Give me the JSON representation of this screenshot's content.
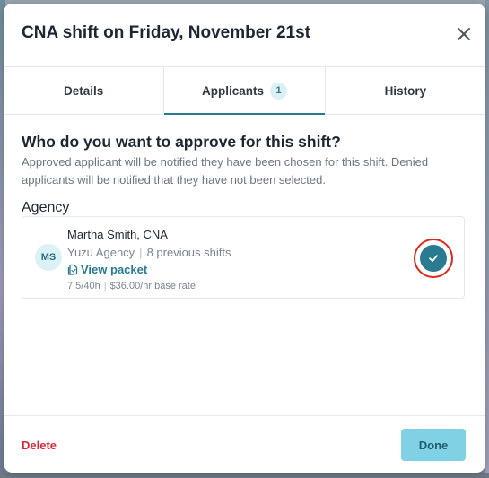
{
  "modal": {
    "title": "CNA shift on Friday, November 21st",
    "close_icon": "close-icon"
  },
  "tabs": [
    {
      "label": "Details",
      "active": false
    },
    {
      "label": "Applicants",
      "badge": "1",
      "active": true
    },
    {
      "label": "History",
      "active": false
    }
  ],
  "prompt": {
    "heading": "Who do you want to approve for this shift?",
    "description": "Approved applicant will be notified they have been chosen for this shift. Denied applicants will be notified that they have not been selected."
  },
  "section": {
    "label": "Agency"
  },
  "applicant": {
    "initials": "MS",
    "name": "Martha Smith, CNA",
    "agency": "Yuzu Agency",
    "separator": "|",
    "previous_shifts": "8 previous shifts",
    "view_packet_label": "View packet",
    "hours": "7.5/40h",
    "rate": "$36.00/hr base rate",
    "approve_icon": "checkmark-icon",
    "approved": true
  },
  "footer": {
    "delete_label": "Delete",
    "done_label": "Done"
  },
  "colors": {
    "accent": "#2a7a92",
    "danger": "#d8283a",
    "done_button": "#7fd1e3",
    "highlight_ring": "#d92a1c"
  }
}
